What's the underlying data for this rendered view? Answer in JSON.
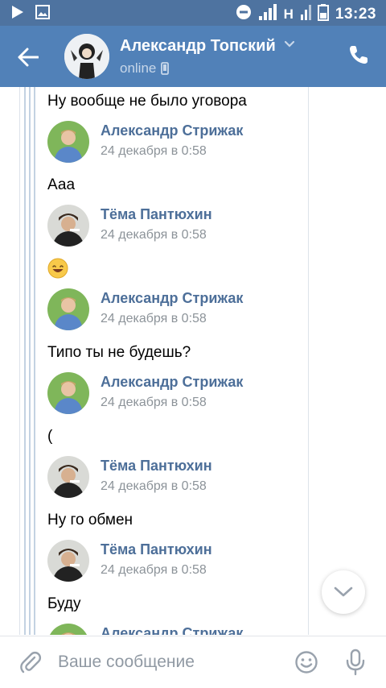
{
  "status_bar": {
    "time": "13:23",
    "network": "H"
  },
  "header": {
    "title": "Александр Топский",
    "status": "online"
  },
  "messages": [
    {
      "type": "text",
      "text": "Ну вообще не было уговора"
    },
    {
      "type": "author",
      "name": "Александр Стрижак",
      "date": "24 декабря в 0:58",
      "avatar": "avatar-strizhak"
    },
    {
      "type": "text",
      "text": "Ааа"
    },
    {
      "type": "author",
      "name": "Тёма Пантюхин",
      "date": "24 декабря в 0:58",
      "avatar": "avatar-pantyukhin"
    },
    {
      "type": "emoji",
      "icon": "smiling-face-emoji"
    },
    {
      "type": "author",
      "name": "Александр Стрижак",
      "date": "24 декабря в 0:58",
      "avatar": "avatar-strizhak"
    },
    {
      "type": "text",
      "text": "Типо ты не будешь?"
    },
    {
      "type": "author",
      "name": "Александр Стрижак",
      "date": "24 декабря в 0:58",
      "avatar": "avatar-strizhak"
    },
    {
      "type": "text",
      "text": "("
    },
    {
      "type": "author",
      "name": "Тёма Пантюхин",
      "date": "24 декабря в 0:58",
      "avatar": "avatar-pantyukhin"
    },
    {
      "type": "text",
      "text": "Ну го обмен"
    },
    {
      "type": "author",
      "name": "Тёма Пантюхин",
      "date": "24 декабря в 0:58",
      "avatar": "avatar-pantyukhin"
    },
    {
      "type": "text",
      "text": "Буду"
    },
    {
      "type": "author",
      "name": "Александр Стрижак",
      "date": "",
      "avatar": "avatar-strizhak"
    }
  ],
  "composer": {
    "placeholder": "Ваше сообщение"
  },
  "colors": {
    "status_bar": "#4e73a0",
    "header": "#5181b8",
    "author_link": "#4d6f99",
    "date": "#8c9399"
  }
}
